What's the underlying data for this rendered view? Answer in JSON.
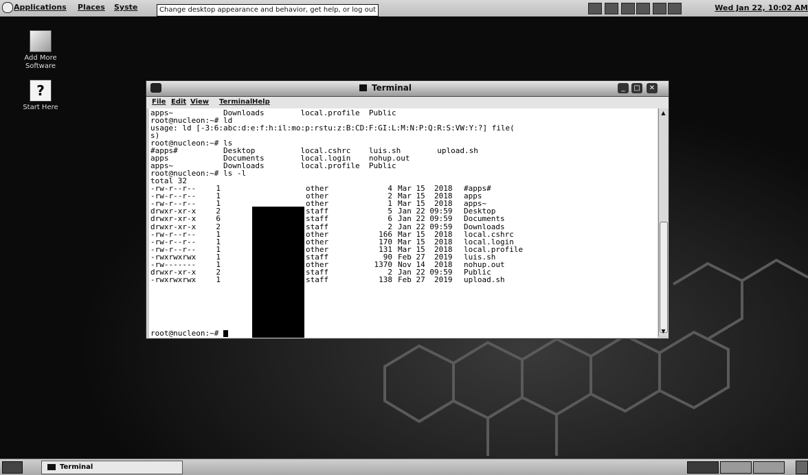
{
  "top_panel": {
    "applications": "Applications",
    "places": "Places",
    "system": "Syste",
    "tooltip": "Change desktop appearance and behavior, get help, or log out",
    "clock": "Wed Jan 22, 10:02 AM"
  },
  "desktop": {
    "icons": [
      {
        "label": "Add More Software"
      },
      {
        "label": "Start Here",
        "glyph": "?"
      }
    ]
  },
  "window": {
    "title": "Terminal",
    "menu": [
      "File",
      "Edit",
      "View",
      "Terminal",
      "Help"
    ],
    "lines": [
      "apps~           Downloads        local.profile  Public",
      "root@nucleon:~# ld",
      "usage: ld [-3:6:abc:d:e:f:h:il:mo:p:rstu:z:B:CD:F:GI:L:M:N:P:Q:R:S:VW:Y:?] file(",
      "s)",
      "root@nucleon:~# ls",
      "#apps#          Desktop          local.cshrc    luis.sh        upload.sh",
      "apps            Documents        local.login    nohup.out",
      "apps~           Downloads        local.profile  Public",
      "root@nucleon:~# ls -l",
      "total 32"
    ],
    "listing": [
      {
        "perms": "-rw-r--r--",
        "links": "1",
        "group": "other",
        "size": "4",
        "date": "Mar 15  2018",
        "name": "#apps#"
      },
      {
        "perms": "-rw-r--r--",
        "links": "1",
        "group": "other",
        "size": "2",
        "date": "Mar 15  2018",
        "name": "apps"
      },
      {
        "perms": "-rw-r--r--",
        "links": "1",
        "group": "other",
        "size": "1",
        "date": "Mar 15  2018",
        "name": "apps~"
      },
      {
        "perms": "drwxr-xr-x",
        "links": "2",
        "group": "staff",
        "size": "5",
        "date": "Jan 22 09:59",
        "name": "Desktop"
      },
      {
        "perms": "drwxr-xr-x",
        "links": "6",
        "group": "staff",
        "size": "6",
        "date": "Jan 22 09:59",
        "name": "Documents"
      },
      {
        "perms": "drwxr-xr-x",
        "links": "2",
        "group": "staff",
        "size": "2",
        "date": "Jan 22 09:59",
        "name": "Downloads"
      },
      {
        "perms": "-rw-r--r--",
        "links": "1",
        "group": "other",
        "size": "166",
        "date": "Mar 15  2018",
        "name": "local.cshrc"
      },
      {
        "perms": "-rw-r--r--",
        "links": "1",
        "group": "other",
        "size": "170",
        "date": "Mar 15  2018",
        "name": "local.login"
      },
      {
        "perms": "-rw-r--r--",
        "links": "1",
        "group": "other",
        "size": "131",
        "date": "Mar 15  2018",
        "name": "local.profile"
      },
      {
        "perms": "-rwxrwxrwx",
        "links": "1",
        "group": "staff",
        "size": "90",
        "date": "Feb 27  2019",
        "name": "luis.sh"
      },
      {
        "perms": "-rw-------",
        "links": "1",
        "group": "other",
        "size": "1370",
        "date": "Nov 14  2018",
        "name": "nohup.out"
      },
      {
        "perms": "drwxr-xr-x",
        "links": "2",
        "group": "staff",
        "size": "2",
        "date": "Jan 22 09:59",
        "name": "Public"
      },
      {
        "perms": "-rwxrwxrwx",
        "links": "1",
        "group": "staff",
        "size": "138",
        "date": "Feb 27  2019",
        "name": "upload.sh"
      }
    ],
    "prompt": "root@nucleon:~# "
  },
  "bottom_panel": {
    "task_label": "Terminal"
  }
}
